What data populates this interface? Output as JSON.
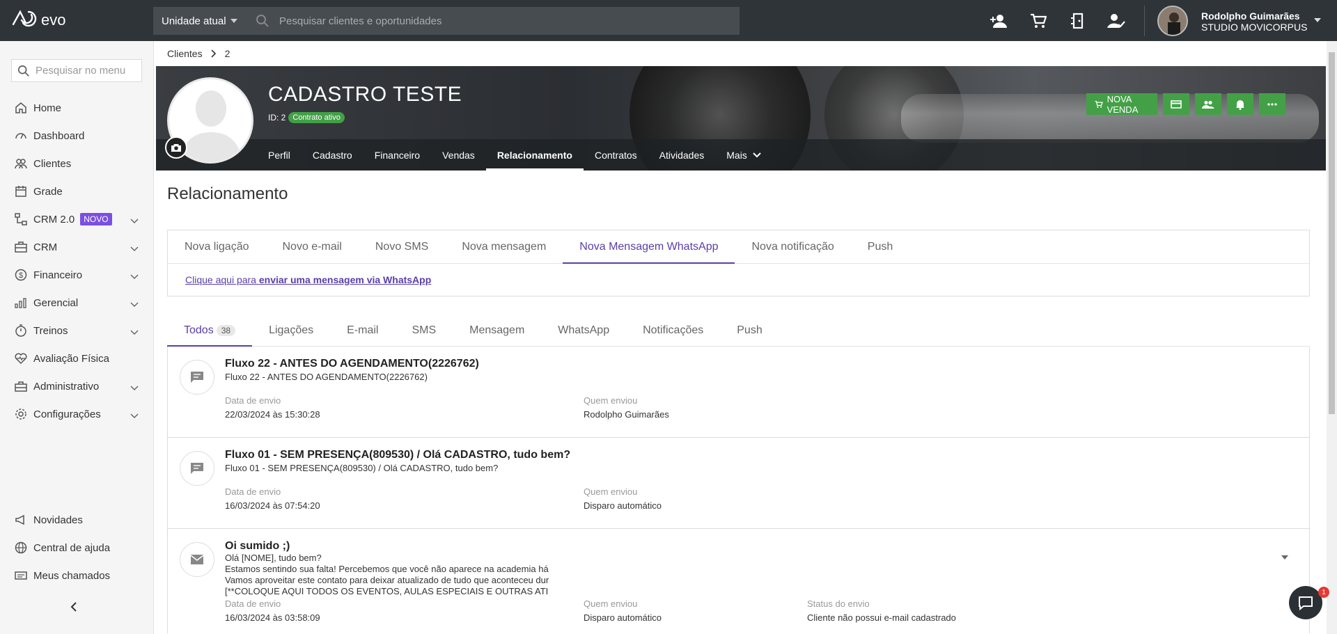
{
  "topbar": {
    "logo_text": "evo",
    "unit_select": "Unidade atual",
    "search_placeholder": "Pesquisar clientes e oportunidades",
    "user_name": "Rodolpho Guimarães",
    "user_studio": "STUDIO MOVICORPUS",
    "icons": [
      "add-user-icon",
      "cart-icon",
      "door-exit-icon",
      "user-check-icon"
    ]
  },
  "sidebar": {
    "search_placeholder": "Pesquisar no menu",
    "items": [
      {
        "label": "Home",
        "icon": "home-icon"
      },
      {
        "label": "Dashboard",
        "icon": "dashboard-icon"
      },
      {
        "label": "Clientes",
        "icon": "users-icon"
      },
      {
        "label": "Grade",
        "icon": "calendar-icon"
      },
      {
        "label": "CRM 2.0",
        "icon": "crm-icon",
        "badge": "NOVO"
      },
      {
        "label": "CRM",
        "icon": "briefcase-icon"
      },
      {
        "label": "Financeiro",
        "icon": "dollar-icon"
      },
      {
        "label": "Gerencial",
        "icon": "bar-chart-icon"
      },
      {
        "label": "Treinos",
        "icon": "timer-icon"
      },
      {
        "label": "Avaliação Física",
        "icon": "heart-pulse-icon"
      },
      {
        "label": "Administrativo",
        "icon": "toolbox-icon"
      },
      {
        "label": "Configurações",
        "icon": "gear-icon"
      }
    ],
    "bottom_items": [
      {
        "label": "Novidades",
        "icon": "megaphone-icon"
      },
      {
        "label": "Central de ajuda",
        "icon": "globe-icon"
      },
      {
        "label": "Meus chamados",
        "icon": "ticket-icon"
      }
    ]
  },
  "breadcrumb": {
    "root": "Clientes",
    "current": "2"
  },
  "client": {
    "name": "CADASTRO TESTE",
    "id_label": "ID: 2",
    "contract_status": "Contrato ativo",
    "new_sale_label": "NOVA VENDA"
  },
  "profile_tabs": [
    "Perfil",
    "Cadastro",
    "Financeiro",
    "Vendas",
    "Relacionamento",
    "Contratos",
    "Atividades",
    "Mais"
  ],
  "section_title": "Relacionamento",
  "compose": {
    "tabs": [
      "Nova ligação",
      "Novo e-mail",
      "Novo SMS",
      "Nova mensagem",
      "Nova Mensagem WhatsApp",
      "Nova notificação",
      "Push"
    ],
    "link_prefix": "Clique aqui para ",
    "link_bold": "enviar uma mensagem via WhatsApp"
  },
  "history": {
    "tabs": [
      "Todos",
      "Ligações",
      "E-mail",
      "SMS",
      "Mensagem",
      "WhatsApp",
      "Notificações",
      "Push"
    ],
    "todos_count": "38",
    "label_date": "Data de envio",
    "label_sender": "Quem enviou",
    "label_status": "Status do envio",
    "items": [
      {
        "title": "Fluxo 22 - ANTES DO AGENDAMENTO(2226762)",
        "subtitle": "Fluxo 22 - ANTES DO AGENDAMENTO(2226762)",
        "date": "22/03/2024 às 15:30:28",
        "sender": "Rodolpho Guimarães"
      },
      {
        "title": "Fluxo 01 - SEM PRESENÇA(809530) / Olá CADASTRO, tudo bem?",
        "subtitle": "Fluxo 01 - SEM PRESENÇA(809530) / Olá CADASTRO, tudo bem?",
        "date": "16/03/2024 às 07:54:20",
        "sender": "Disparo automático"
      },
      {
        "title": "Oi sumido ;)",
        "body_lines": [
          "Olá [NOME], tudo bem?",
          "Estamos sentindo sua falta! Percebemos que você não aparece na academia há",
          "Vamos aproveitar este contato para deixar atualizado de tudo que aconteceu dur",
          "[**COLOQUE AQUI TODOS OS EVENTOS, AULAS ESPECIAIS E OUTRAS ATI"
        ],
        "date": "16/03/2024 às 03:58:09",
        "sender": "Disparo automático",
        "status": "Cliente não possui e-mail cadastrado"
      }
    ]
  },
  "chat": {
    "unread": "1"
  },
  "colors": {
    "accent": "#5a3ea8",
    "green": "#43a047",
    "topbar": "#2f3438"
  }
}
